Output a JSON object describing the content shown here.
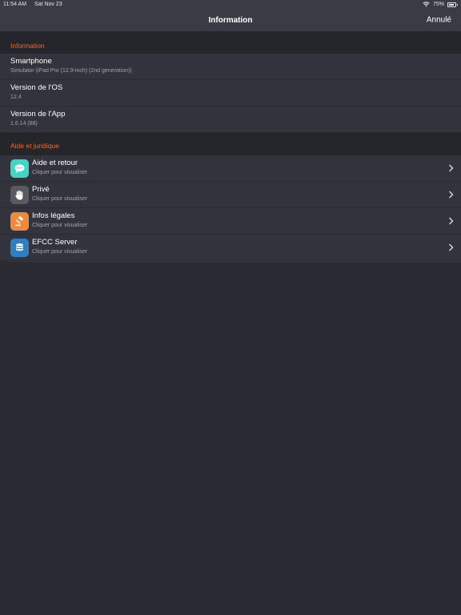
{
  "status_bar": {
    "time": "11:54 AM",
    "date": "Sat Nov 23",
    "battery": "75%"
  },
  "nav": {
    "title": "Information",
    "cancel_label": "Annulé"
  },
  "sections": [
    {
      "header": "Information",
      "rows": [
        {
          "title": "Smartphone",
          "subtitle": "Simulator (iPad Pro (12.9-inch) (2nd generation))"
        },
        {
          "title": "Version de l'OS",
          "subtitle": "12.4"
        },
        {
          "title": "Version de l'App",
          "subtitle": "1.6.14 (88)"
        }
      ]
    },
    {
      "header": "Aide et juridique",
      "rows": [
        {
          "title": "Aide et retour",
          "subtitle": "Cliquer pour visualiser",
          "icon": "chat-bubble-icon",
          "icon_color": "#3fd6c6"
        },
        {
          "title": "Privé",
          "subtitle": "Cliquer pour visualiser",
          "icon": "hand-icon",
          "icon_color": "#5a5a5f"
        },
        {
          "title": "Infos légales",
          "subtitle": "Cliquer pour visualiser",
          "icon": "gavel-icon",
          "icon_color": "#f08a3a"
        },
        {
          "title": "EFCC Server",
          "subtitle": "Cliquer pour visualiser",
          "icon": "database-icon",
          "icon_color": "#2f7fc4"
        }
      ]
    }
  ],
  "colors": {
    "accent": "#f06a26",
    "background": "#2a2a33",
    "row_background": "#33333d",
    "bar_background": "#3b3b45"
  }
}
